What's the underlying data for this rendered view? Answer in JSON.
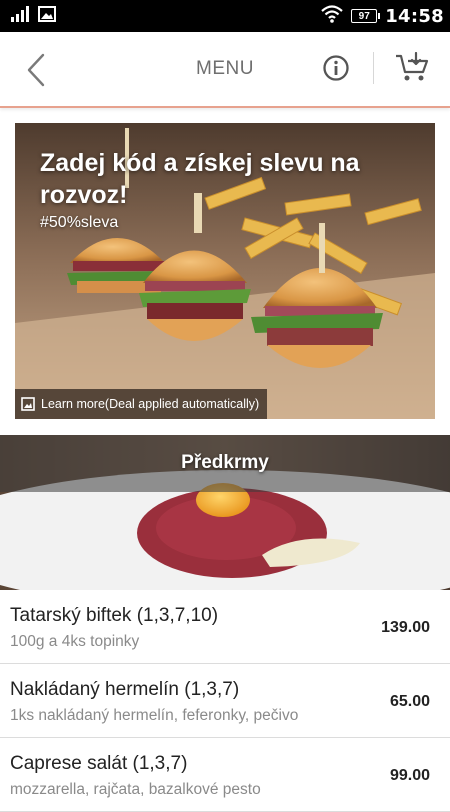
{
  "status_bar": {
    "time": "14:58",
    "battery": "97",
    "icons": [
      "signal-icon",
      "image-notification-icon",
      "wifi-icon",
      "battery-icon"
    ]
  },
  "app_bar": {
    "title": "MENU",
    "back_icon": "chevron-left-icon",
    "info_icon": "info-icon",
    "cart_icon": "cart-icon",
    "divider_color": "#e7a28e"
  },
  "promo": {
    "title": "Zadej kód a získej slevu na rozvoz!",
    "hashtag": "#50%sleva",
    "footer_text": "Learn more(Deal applied automatically)",
    "image": "mini-burgers-with-fries-photo"
  },
  "category": {
    "title": "Předkrmy",
    "image": "beef-tartare-with-egg-yolk-photo"
  },
  "menu_items": [
    {
      "name": "Tatarský biftek (1,3,7,10)",
      "description": "100g a 4ks topinky",
      "price": "139.00"
    },
    {
      "name": "Nakládaný hermelín (1,3,7)",
      "description": "1ks nakládaný hermelín, feferonky, pečivo",
      "price": "65.00"
    },
    {
      "name": "Caprese salát (1,3,7)",
      "description": "mozzarella, rajčata, bazalkové pesto",
      "price": "99.00"
    }
  ]
}
